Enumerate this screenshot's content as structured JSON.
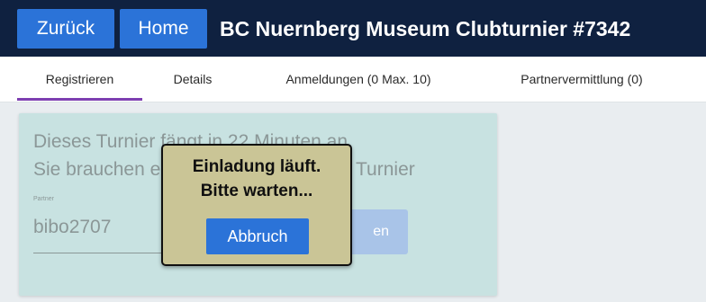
{
  "header": {
    "back_label": "Zurück",
    "home_label": "Home",
    "title": "BC Nuernberg Museum Clubturnier #7342"
  },
  "tabs": [
    {
      "label": "Registrieren",
      "active": true
    },
    {
      "label": "Details"
    },
    {
      "label": "Anmeldungen (0 Max. 10)"
    },
    {
      "label": "Partnervermittlung (0)"
    }
  ],
  "card": {
    "line1": "Dieses Turnier fängt in 22 Minuten an.",
    "line2": "Sie brauchen einen Partner für dieses Turnier",
    "partner_label": "Partner",
    "partner_value": "bibo2707",
    "invite_label": "en"
  },
  "popup": {
    "line1": "Einladung läuft.",
    "line2": "Bitte warten...",
    "abort_label": "Abbruch"
  },
  "colors": {
    "header_bg": "#0f2140",
    "button_blue": "#2b73d8",
    "tab_active": "#7d3fb1",
    "card_bg": "#c8e2e1",
    "popup_bg": "#cac596"
  }
}
